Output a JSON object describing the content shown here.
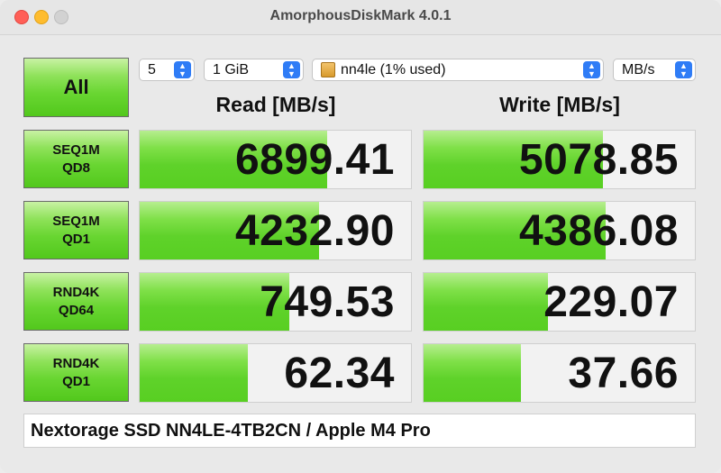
{
  "window": {
    "title": "AmorphousDiskMark 4.0.1"
  },
  "toolbar": {
    "count": "5",
    "size": "1 GiB",
    "drive": "nn4le (1% used)",
    "unit": "MB/s",
    "all_label": "All"
  },
  "headers": {
    "read": "Read [MB/s]",
    "write": "Write [MB/s]"
  },
  "tests": [
    {
      "line1": "SEQ1M",
      "line2": "QD8",
      "read": "6899.41",
      "write": "5078.85",
      "read_level": 0.69,
      "write_level": 0.66
    },
    {
      "line1": "SEQ1M",
      "line2": "QD1",
      "read": "4232.90",
      "write": "4386.08",
      "read_level": 0.66,
      "write_level": 0.67
    },
    {
      "line1": "RND4K",
      "line2": "QD64",
      "read": "749.53",
      "write": "229.07",
      "read_level": 0.55,
      "write_level": 0.46
    },
    {
      "line1": "RND4K",
      "line2": "QD1",
      "read": "62.34",
      "write": "37.66",
      "read_level": 0.4,
      "write_level": 0.36
    }
  ],
  "footer": {
    "text": "Nextorage SSD NN4LE-4TB2CN / Apple M4 Pro"
  },
  "colors": {
    "accent": "#2f7cf6",
    "bar_green": "#5fd22a"
  }
}
